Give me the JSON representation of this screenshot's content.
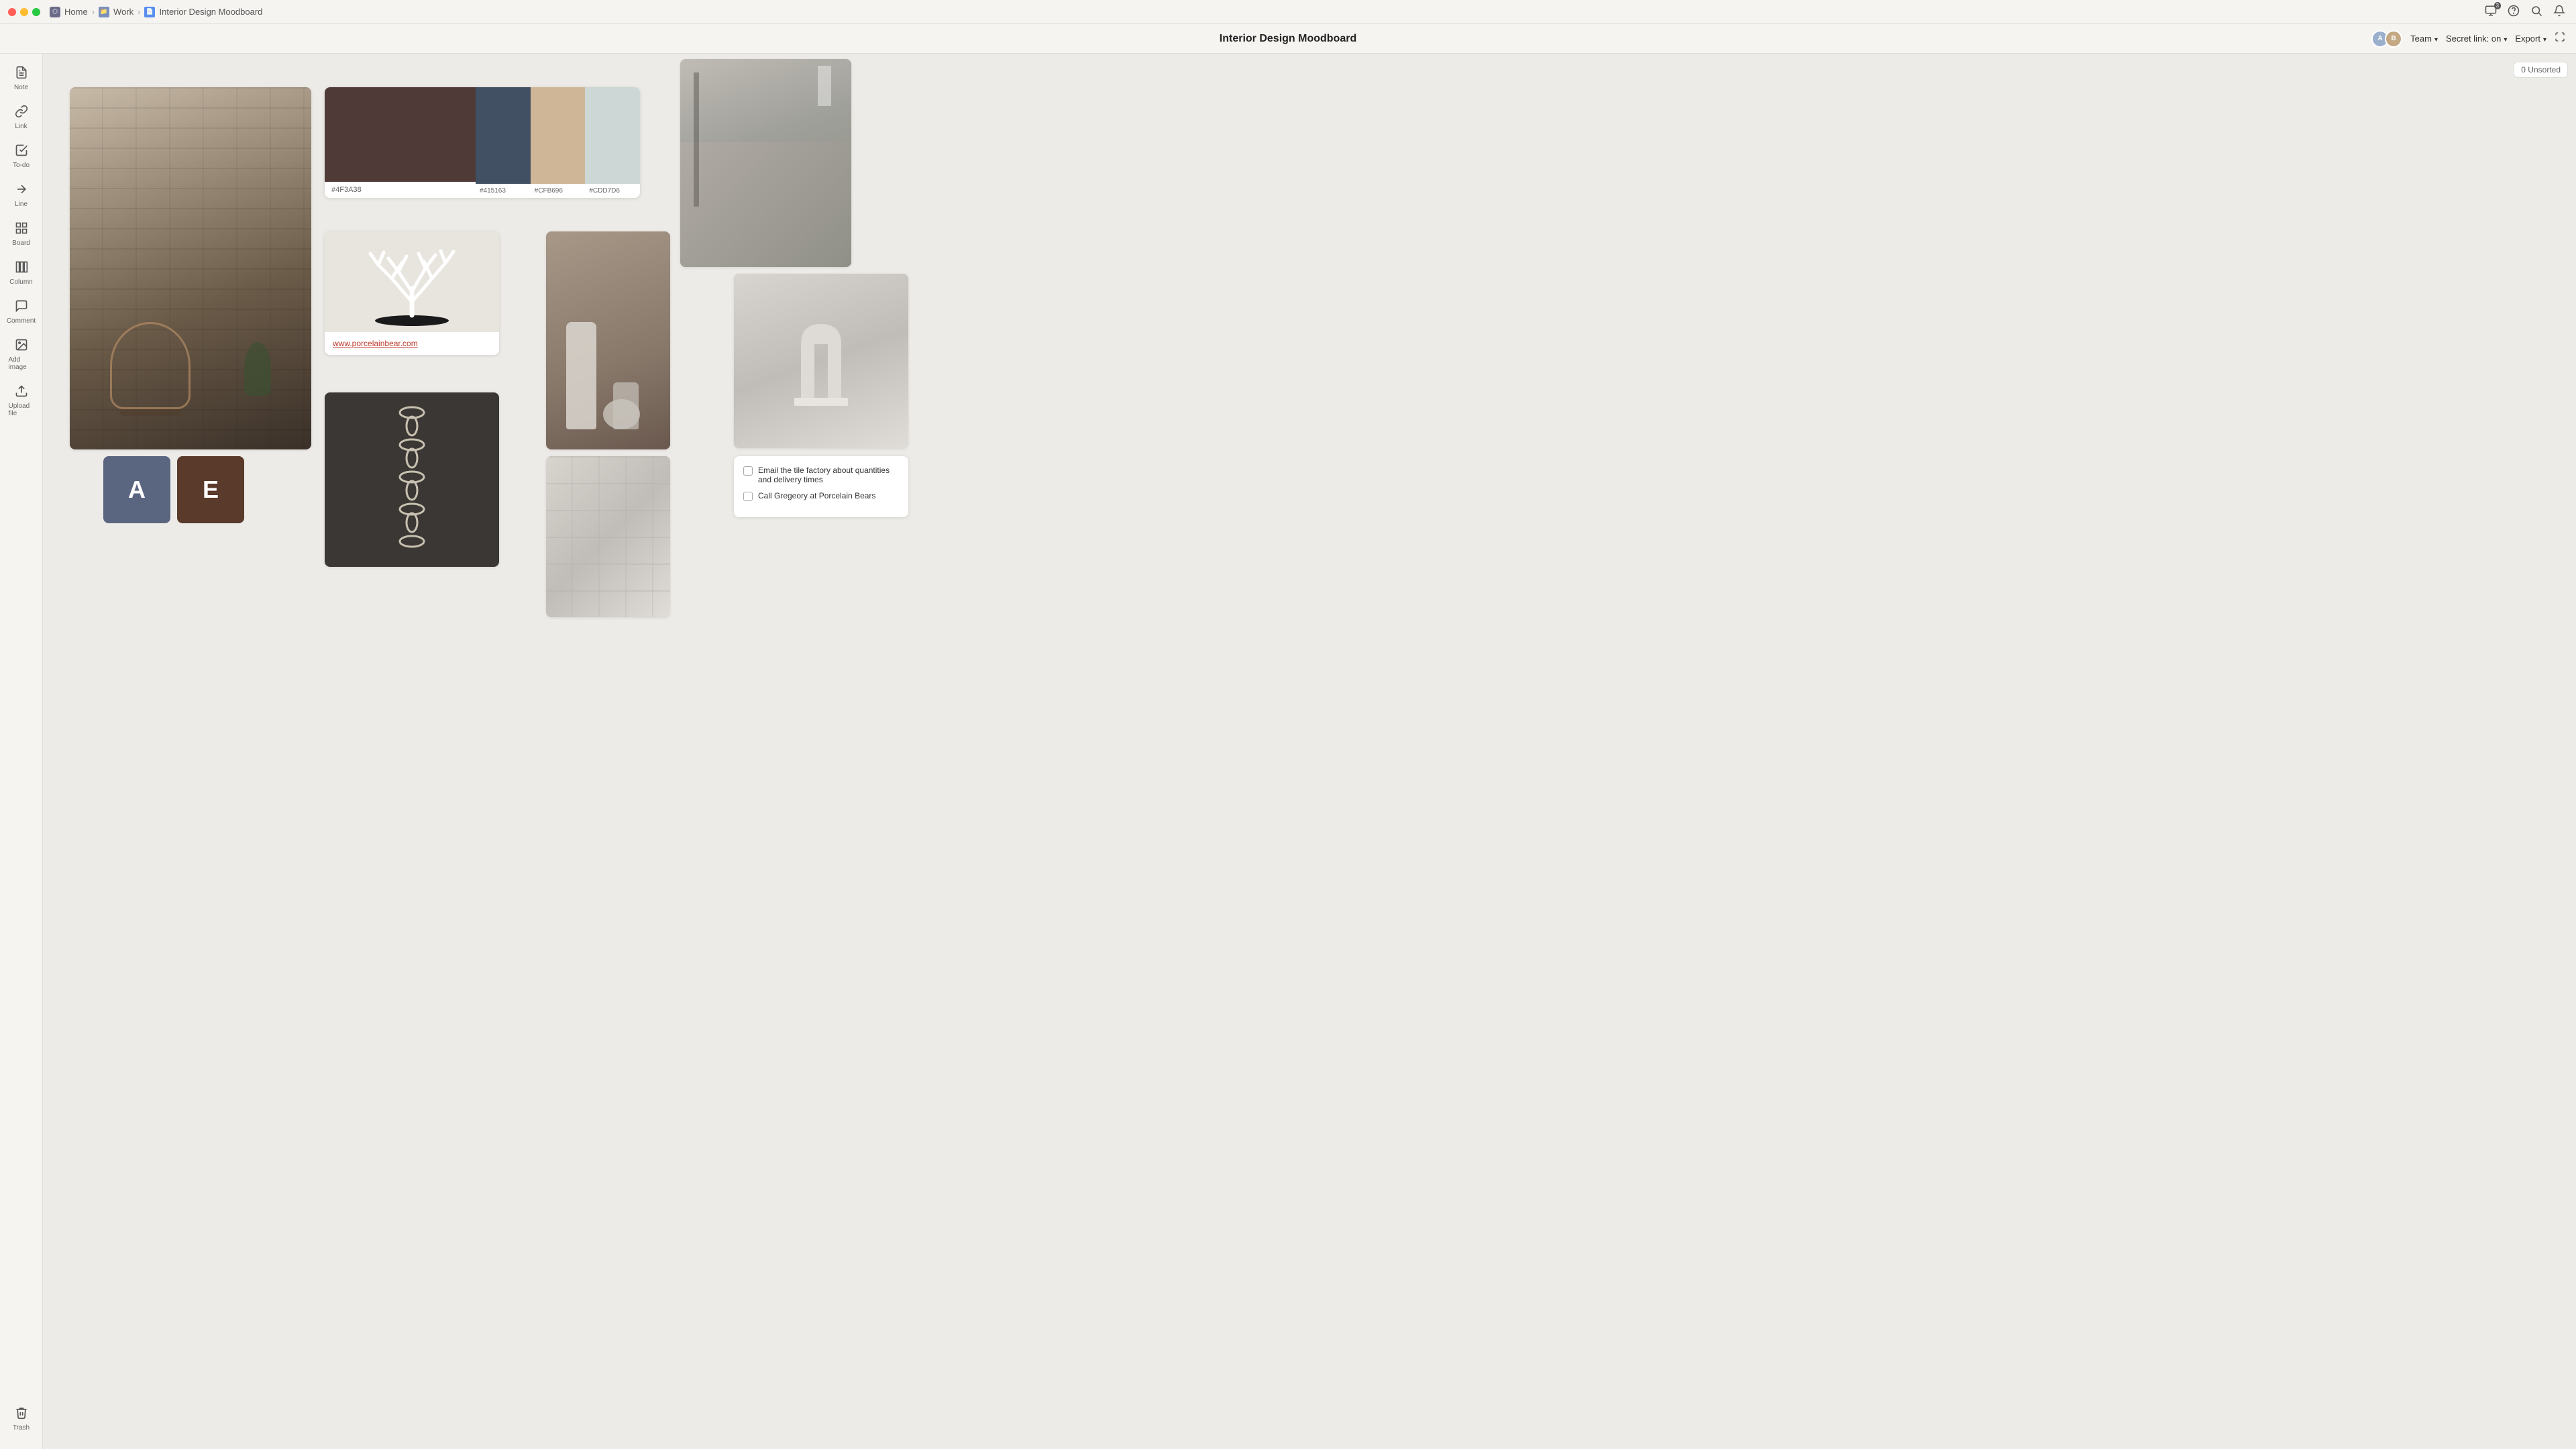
{
  "titlebar": {
    "breadcrumbs": [
      "Home",
      "Work",
      "Interior Design Moodboard"
    ],
    "home_icon": "⬡",
    "work_label": "Work",
    "page_label": "Interior Design Moodboard"
  },
  "toolbar": {
    "title": "Interior Design Moodboard",
    "team_label": "Team",
    "secret_link_label": "Secret link: on",
    "export_label": "Export",
    "notification_count": "3"
  },
  "sidebar": {
    "items": [
      {
        "id": "note",
        "label": "Note",
        "icon": "☰"
      },
      {
        "id": "link",
        "label": "Link",
        "icon": "🔗"
      },
      {
        "id": "todo",
        "label": "To-do",
        "icon": "☑"
      },
      {
        "id": "line",
        "label": "Line",
        "icon": "╱"
      },
      {
        "id": "board",
        "label": "Board",
        "icon": "⊞"
      },
      {
        "id": "column",
        "label": "Column",
        "icon": "⬚"
      },
      {
        "id": "comment",
        "label": "Comment",
        "icon": "💬"
      },
      {
        "id": "add-image",
        "label": "Add image",
        "icon": "🖼"
      },
      {
        "id": "upload",
        "label": "Upload file",
        "icon": "⬆"
      }
    ],
    "bottom": [
      {
        "id": "trash",
        "label": "Trash",
        "icon": "🗑"
      }
    ]
  },
  "canvas": {
    "unsorted_label": "0 Unsorted"
  },
  "palette": {
    "colors": [
      {
        "hex": "#4F3A38",
        "label": "#4F3A38"
      },
      {
        "hex": "#415163",
        "label": "#415163"
      },
      {
        "hex": "#CFB696",
        "label": "#CFB696"
      },
      {
        "hex": "#CDD7D6",
        "label": "#CDD7D6"
      }
    ]
  },
  "link_card": {
    "url": "www.porcelainbear.com"
  },
  "checklist": {
    "items": [
      {
        "text": "Email the tile factory about quantities and delivery times",
        "checked": false
      },
      {
        "text": "Call Gregeory at Porcelain Bears",
        "checked": false
      }
    ]
  },
  "avatars": [
    {
      "letter": "A",
      "color": "#5a6680"
    },
    {
      "letter": "E",
      "color": "#5a3a2a"
    }
  ]
}
